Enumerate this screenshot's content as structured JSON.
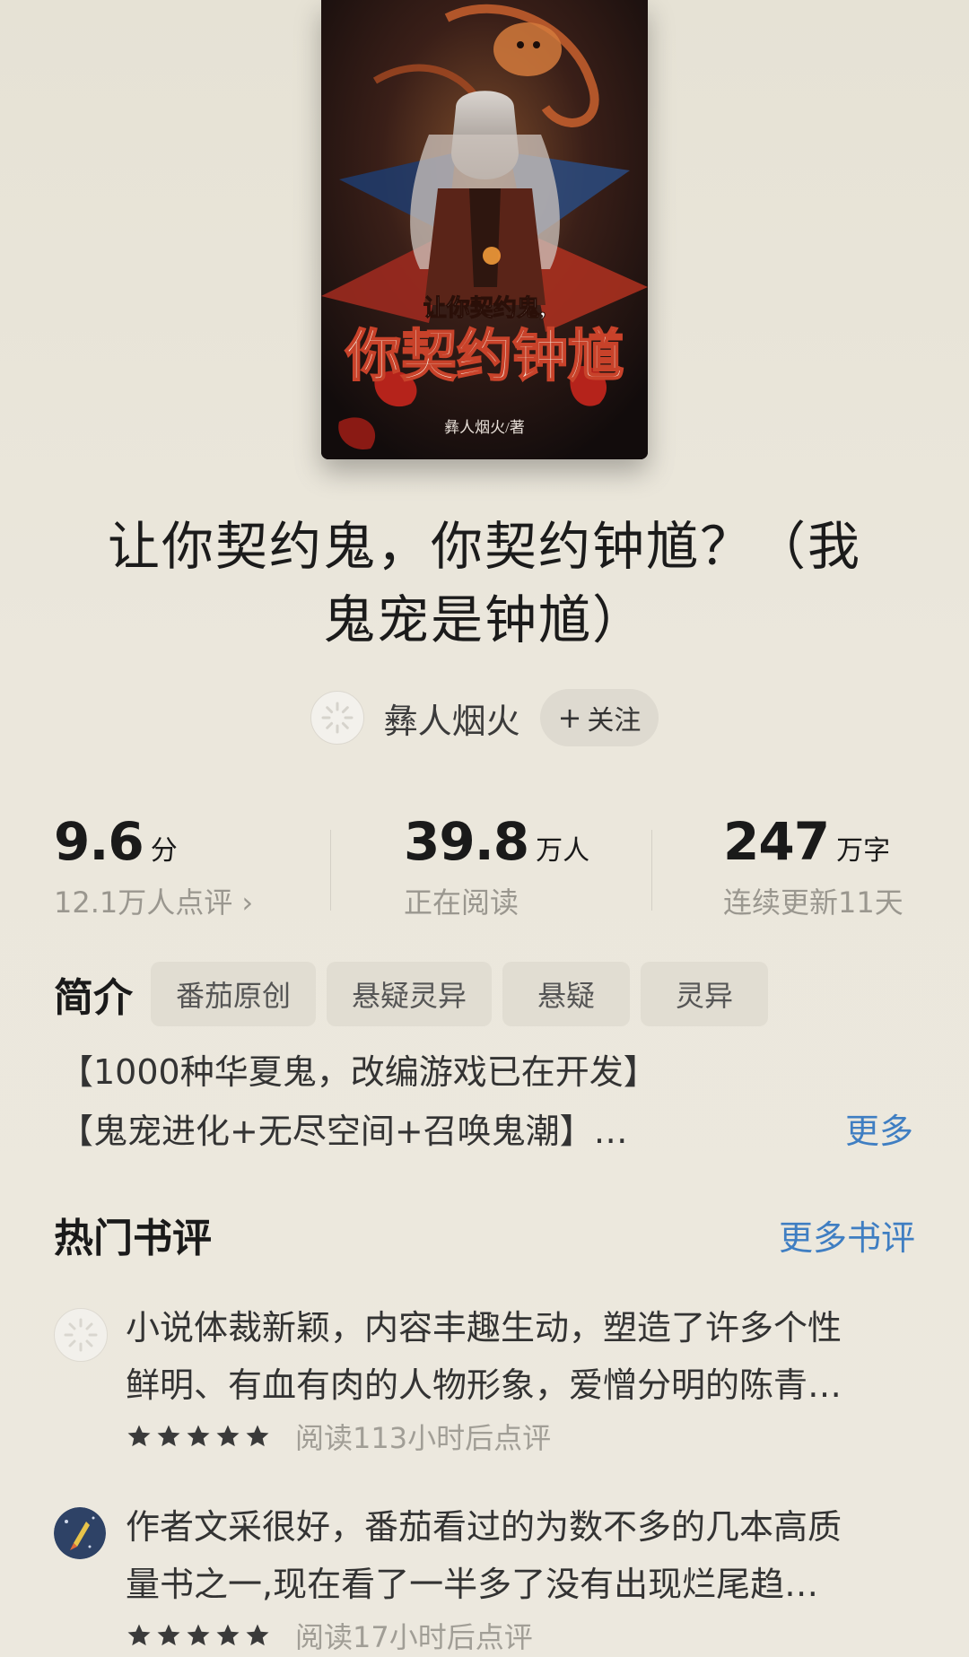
{
  "book": {
    "title_line1": "让你契约鬼，你契约钟馗？（我",
    "title_line2": "鬼宠是钟馗）",
    "cover": {
      "small_title": "让你契约鬼,",
      "big_title": "你契约钟馗",
      "author_credit": "彝人烟火/著"
    }
  },
  "author": {
    "name": "彝人烟火",
    "follow_label": "关注"
  },
  "stats": {
    "rating": {
      "value": "9.6",
      "unit": "分",
      "sub": "12.1万人点评 ›"
    },
    "readers": {
      "value": "39.8",
      "unit": "万人",
      "sub": "正在阅读"
    },
    "words": {
      "value": "247",
      "unit": "万字",
      "sub": "连续更新11天"
    }
  },
  "intro": {
    "label": "简介",
    "tags": [
      "番茄原创",
      "悬疑灵异",
      "悬疑",
      "灵异"
    ],
    "lines": [
      "【1000种华夏鬼，改编游戏已在开发】",
      "【鬼宠进化+无尽空间+召唤鬼潮】…"
    ],
    "more_label": "更多"
  },
  "reviews": {
    "title": "热门书评",
    "more_label": "更多书评",
    "items": [
      {
        "line1": "小说体裁新颖，内容丰趣生动，塑造了许多个性",
        "line2": "鲜明、有血有肉的人物形象，爱憎分明的陈青…",
        "rating": 5,
        "note": "阅读113小时后点评"
      },
      {
        "line1": "作者文采很好，番茄看过的为数不多的几本高质",
        "line2": "量书之一,现在看了一半多了没有出现烂尾趋…",
        "rating": 5,
        "note": "阅读17小时后点评"
      }
    ]
  },
  "colors": {
    "background": "#ebe7db",
    "link": "#3f7ec2",
    "tag_bg": "#e1ddd2",
    "muted_text": "#9a978f"
  }
}
